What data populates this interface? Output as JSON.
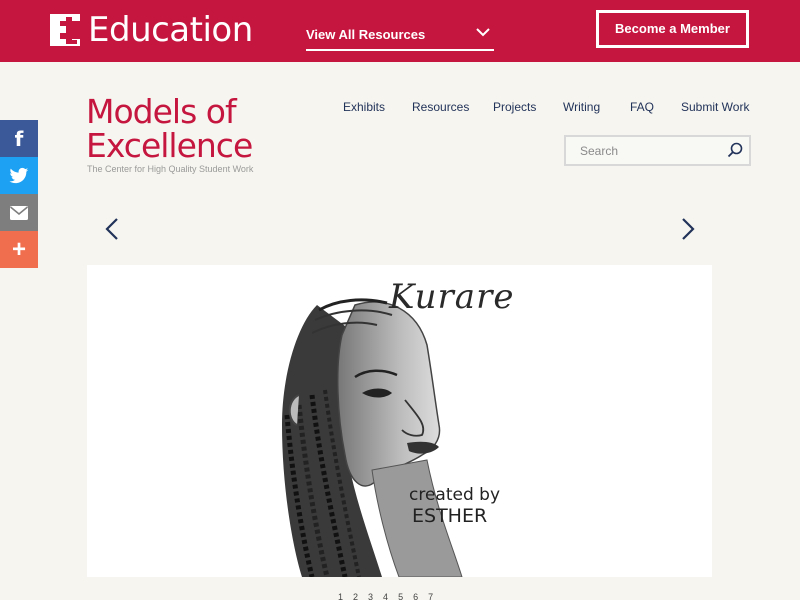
{
  "header": {
    "logo_text": "Education",
    "resources_dropdown": "View All Resources",
    "member_button": "Become a Member"
  },
  "brand": {
    "title_line1": "Models of",
    "title_line2": "Excellence",
    "subtitle": "The Center for High Quality Student Work"
  },
  "nav": {
    "items": [
      "Exhibits",
      "Resources",
      "Projects",
      "Writing",
      "FAQ",
      "Submit Work"
    ]
  },
  "search": {
    "placeholder": "Search"
  },
  "social": {
    "icons": [
      "facebook-icon",
      "twitter-icon",
      "email-icon",
      "plus-icon"
    ]
  },
  "slide": {
    "title": "Kurare",
    "credit_line1": "created by",
    "credit_line2": "ESTHER"
  },
  "pager": {
    "pages": [
      "1",
      "2",
      "3",
      "4",
      "5",
      "6",
      "7"
    ]
  },
  "colors": {
    "brand": "#c5163f",
    "nav_text": "#22335a",
    "background": "#f6f5ef"
  }
}
